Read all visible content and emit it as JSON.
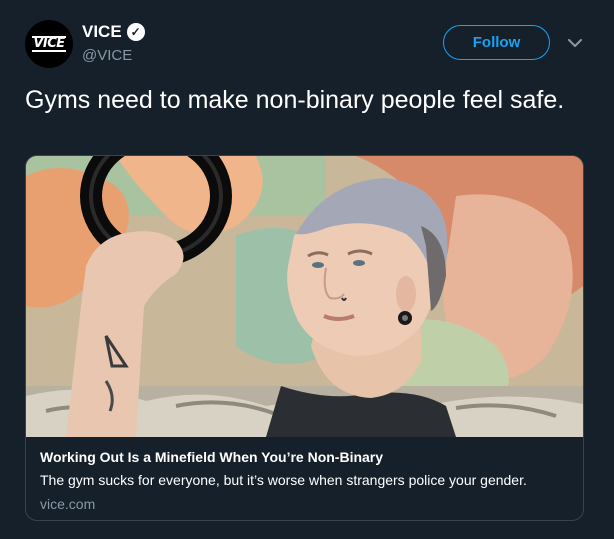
{
  "author": {
    "display_name": "VICE",
    "handle": "@VICE",
    "verified_glyph": "✓",
    "avatar_logo": "VICE",
    "avatar_icon": "vice-logo-icon"
  },
  "actions": {
    "follow_label": "Follow",
    "more_icon": "chevron-down-icon"
  },
  "tweet": {
    "text": "Gyms need to make non-binary people feel safe."
  },
  "card": {
    "title": "Working Out Is a Minefield When You’re Non-Binary",
    "description": "The gym sucks for everyone, but it’s worse when strangers police your gender.",
    "domain": "vice.com",
    "image_icon": "article-photo-image"
  },
  "colors": {
    "background": "#15202b",
    "accent": "#1da1f2",
    "muted_text": "#8899a6",
    "border": "#38444d"
  }
}
